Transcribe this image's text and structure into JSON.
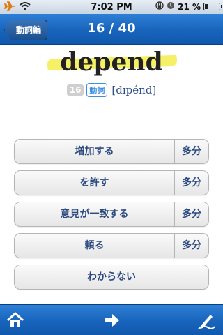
{
  "status": {
    "time": "7:02 PM",
    "battery": "21 %",
    "battery_level": 0.21
  },
  "nav": {
    "back_label": "動詞編",
    "title": "16 / 40"
  },
  "word": {
    "text": "depend",
    "number": "16",
    "pos": "動詞",
    "pronunciation": "[dɪpénd]"
  },
  "choices": [
    {
      "label": "増加する",
      "side": "多分"
    },
    {
      "label": "を許す",
      "side": "多分"
    },
    {
      "label": "意見が一致する",
      "side": "多分"
    },
    {
      "label": "頼る",
      "side": "多分"
    },
    {
      "label": "わからない"
    }
  ],
  "toolbar": {
    "icons": [
      "home-icon",
      "arrow-right-icon",
      "pen-icon"
    ]
  },
  "colors": {
    "nav": "#1a66bd",
    "highlight": "#f4ee55",
    "choice_text": "#2c4a80"
  }
}
